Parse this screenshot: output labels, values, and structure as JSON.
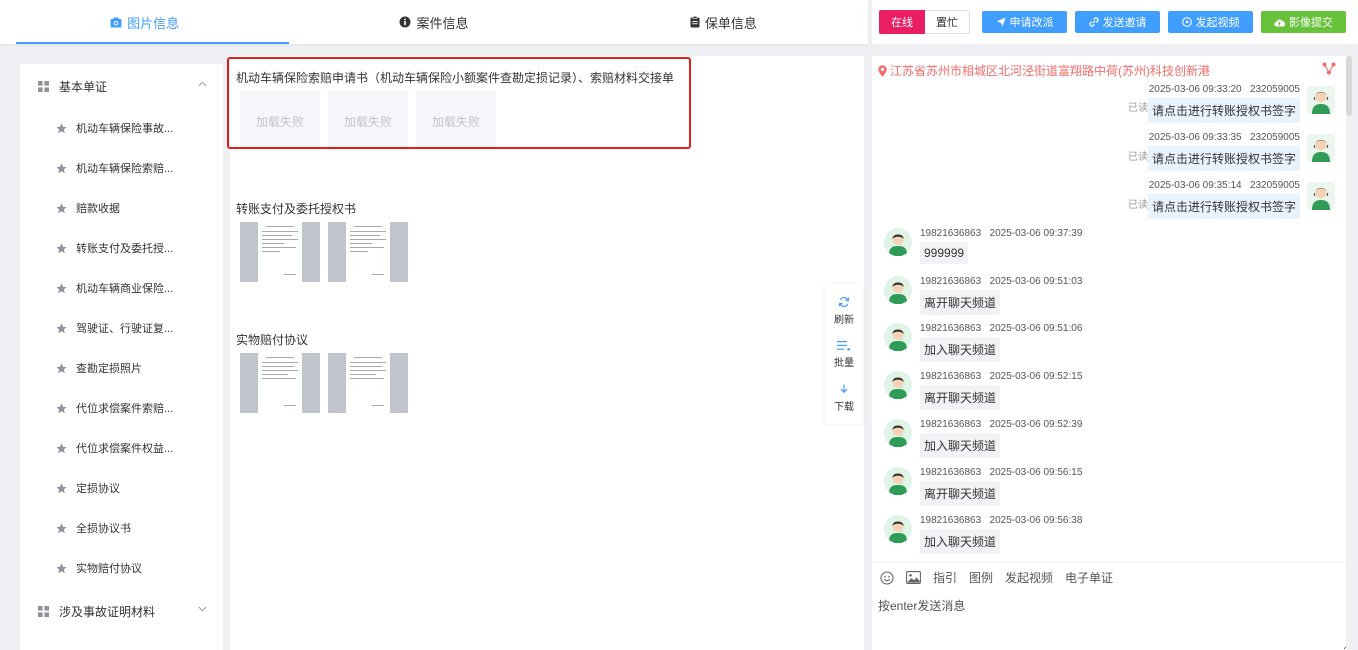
{
  "tabs": [
    {
      "label": "图片信息",
      "icon": "camera-icon",
      "active": true
    },
    {
      "label": "案件信息",
      "icon": "info-icon",
      "active": false
    },
    {
      "label": "保单信息",
      "icon": "clipboard-icon",
      "active": false
    }
  ],
  "toolbar": {
    "status_online": "在线",
    "status_busy": "置忙",
    "buttons": [
      {
        "label": "申请改派",
        "icon": "send-icon",
        "color": "blue"
      },
      {
        "label": "发送邀请",
        "icon": "link-icon",
        "color": "blue"
      },
      {
        "label": "发起视频",
        "icon": "video-icon",
        "color": "blue"
      },
      {
        "label": "影像提交",
        "icon": "cloud-upload-icon",
        "color": "green"
      }
    ]
  },
  "sidebar": {
    "group1": {
      "label": "基本单证",
      "expanded": true
    },
    "items": [
      "机动车辆保险事故...",
      "机动车辆保险索赔...",
      "赔款收据",
      "转账支付及委托授...",
      "机动车辆商业保险...",
      "驾驶证、行驶证复...",
      "查勘定损照片",
      "代位求偿案件索赔...",
      "代位求偿案件权益...",
      "定损协议",
      "全损协议书",
      "实物赔付协议"
    ],
    "group2": {
      "label": "涉及事故证明材料",
      "expanded": false
    }
  },
  "main": {
    "section1": {
      "title": "机动车辆保险索赔申请书（机动车辆保险小额案件查勘定损记录）、索赔材料交接单",
      "failed_label": "加载失败",
      "failed_count": 3
    },
    "section2": {
      "title": "转账支付及委托授权书"
    },
    "section3": {
      "title": "实物赔付协议"
    }
  },
  "float_tools": [
    {
      "label": "刷新",
      "icon": "refresh-icon"
    },
    {
      "label": "批量",
      "icon": "list-icon"
    },
    {
      "label": "下载",
      "icon": "download-icon"
    }
  ],
  "chat": {
    "location": "江苏省苏州市相城区北河泾街道富翔路中荷(苏州)科技创新港",
    "read_label": "已读",
    "self_messages": [
      {
        "time": "2025-03-06 09:33:20",
        "sender": "232059005",
        "text": "请点击进行转账授权书签字"
      },
      {
        "time": "2025-03-06 09:33:35",
        "sender": "232059005",
        "text": "请点击进行转账授权书签字"
      },
      {
        "time": "2025-03-06 09:35:14",
        "sender": "232059005",
        "text": "请点击进行转账授权书签字"
      }
    ],
    "other_messages": [
      {
        "sender": "19821636863",
        "time": "2025-03-06 09:37:39",
        "text": "999999"
      },
      {
        "sender": "19821636863",
        "time": "2025-03-06 09:51:03",
        "text": "离开聊天频道"
      },
      {
        "sender": "19821636863",
        "time": "2025-03-06 09:51:06",
        "text": "加入聊天频道"
      },
      {
        "sender": "19821636863",
        "time": "2025-03-06 09:52:15",
        "text": "离开聊天频道"
      },
      {
        "sender": "19821636863",
        "time": "2025-03-06 09:52:39",
        "text": "加入聊天频道"
      },
      {
        "sender": "19821636863",
        "time": "2025-03-06 09:56:15",
        "text": "离开聊天频道"
      },
      {
        "sender": "19821636863",
        "time": "2025-03-06 09:56:38",
        "text": "加入聊天频道"
      }
    ],
    "tools": [
      {
        "label": "",
        "icon": "emoji-icon"
      },
      {
        "label": "",
        "icon": "image-icon"
      },
      {
        "label": "指引"
      },
      {
        "label": "图例"
      },
      {
        "label": "发起视频"
      },
      {
        "label": "电子单证"
      }
    ],
    "input_placeholder": "按enter发送消息"
  },
  "colors": {
    "accent": "#409eff",
    "online": "#e91e63",
    "submit": "#67c23a",
    "location": "#f56c6c",
    "highlight_box": "#e02020"
  }
}
